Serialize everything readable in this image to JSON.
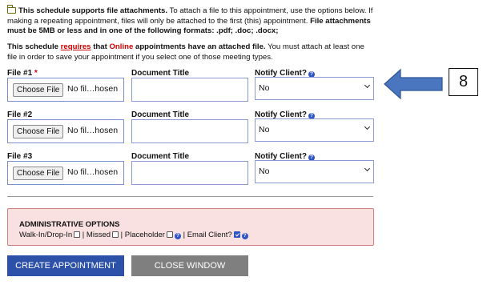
{
  "intro": {
    "lead": "This schedule supports file attachments.",
    "rest": " To attach a file to this appointment, use the options below. If making a repeating appointment, files will only be attached to the first (this) appointment. ",
    "bold_tail": "File attachments must be 5MB or less and in one of the following formats: .pdf; .doc; .docx;"
  },
  "requirement": {
    "prefix": "This schedule ",
    "requires": "requires",
    "mid1": " that ",
    "online": "Online",
    "mid2": " appointments have an attached file.",
    "rest": " You must attach at least one file in order to save your appointment if you select one of those meeting types."
  },
  "columns": {
    "document_title": "Document Title",
    "notify_client": "Notify Client?"
  },
  "required_mark": "*",
  "files": [
    {
      "label": "File #1",
      "button": "Choose File",
      "status": "No fil…hosen",
      "notify": "No"
    },
    {
      "label": "File #2",
      "button": "Choose File",
      "status": "No fil…hosen",
      "notify": "No"
    },
    {
      "label": "File #3",
      "button": "Choose File",
      "status": "No fil…hosen",
      "notify": "No"
    }
  ],
  "admin": {
    "title": "ADMINISTRATIVE OPTIONS",
    "walk_in": "Walk-In/Drop-In",
    "sep": " | ",
    "missed": "Missed",
    "placeholder": "Placeholder",
    "email_client": "Email Client?",
    "email_checked": true
  },
  "buttons": {
    "create": "CREATE APPOINTMENT",
    "close": "CLOSE WINDOW"
  },
  "annotation": {
    "step_number": "8",
    "arrow_color": "#4a76c0"
  },
  "colors": {
    "primary": "#2d50a8",
    "danger": "#d00000",
    "panel_bg": "#f9e1e1"
  }
}
